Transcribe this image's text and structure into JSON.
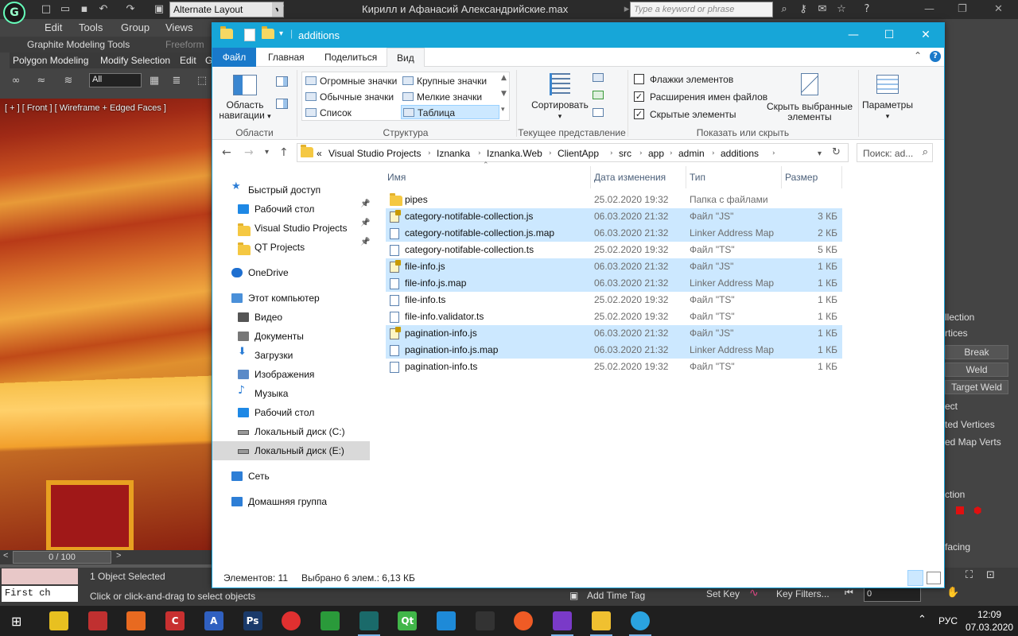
{
  "max": {
    "workspace": "Alternate Layout",
    "file_title": "Кирилл и Афанасий Александрийские.max",
    "search_placeholder": "Type a keyword or phrase",
    "menu": [
      "Edit",
      "Tools",
      "Group",
      "Views"
    ],
    "ribbon_tabs": [
      "Graphite Modeling Tools",
      "Freeform"
    ],
    "ribbon_row2": [
      "Polygon Modeling",
      "Modify Selection",
      "Edit",
      "G"
    ],
    "selection_filter": "All",
    "viewport_label": "[ + ] [ Front ] [ Wireframe + Edged Faces ]",
    "time_slider": "0 / 100",
    "maxscript_text": "First ch",
    "objects_selected": "1 Object Selected",
    "prompt": "Click or click-and-drag to select objects",
    "add_time_tag": "Add Time Tag",
    "set_key": "Set Key",
    "key_filters": "Key Filters...",
    "frame_value": "0",
    "cmd_panel": {
      "buttons": [
        "Break",
        "Weld",
        "Target Weld"
      ],
      "labels": [
        "llection",
        "rtices",
        "ect",
        "ted Vertices",
        "ed Map Verts",
        "ction",
        "facing"
      ]
    }
  },
  "explorer": {
    "title": "additions",
    "tabs": {
      "file": "Файл",
      "home": "Главная",
      "share": "Поделиться",
      "view": "Вид"
    },
    "ribbon": {
      "nav_pane_label": "Область навигации",
      "group_panes": "Области",
      "layouts": [
        "Огромные значки",
        "Крупные значки",
        "Обычные значки",
        "Мелкие значки",
        "Список",
        "Таблица"
      ],
      "group_layout": "Структура",
      "sort_label": "Сортировать",
      "group_current_view": "Текущее представление",
      "checkboxes": [
        {
          "label": "Флажки элементов",
          "checked": false
        },
        {
          "label": "Расширения имен файлов",
          "checked": true
        },
        {
          "label": "Скрытые элементы",
          "checked": true
        }
      ],
      "hide_selected": "Скрыть выбранные элементы",
      "group_show_hide": "Показать или скрыть",
      "options": "Параметры"
    },
    "address": {
      "overflow": "«",
      "segments": [
        "Visual Studio Projects",
        "Iznanka",
        "Iznanka.Web",
        "ClientApp",
        "src",
        "app",
        "admin",
        "additions"
      ],
      "search_placeholder": "Поиск: ad..."
    },
    "nav": [
      {
        "label": "Быстрый доступ",
        "level": 0,
        "icon": "star-icon",
        "pin": false
      },
      {
        "label": "Рабочий стол",
        "level": 1,
        "icon": "desktop-icon",
        "pin": true
      },
      {
        "label": "Visual Studio Projects",
        "level": 1,
        "icon": "folder-icon",
        "pin": true
      },
      {
        "label": "QT Projects",
        "level": 1,
        "icon": "folder-icon",
        "pin": true
      },
      {
        "label": "OneDrive",
        "level": 0,
        "icon": "cloud-icon",
        "pin": false
      },
      {
        "label": "Этот компьютер",
        "level": 0,
        "icon": "computer-icon",
        "pin": false
      },
      {
        "label": "Видео",
        "level": 1,
        "icon": "video-icon",
        "pin": false
      },
      {
        "label": "Документы",
        "level": 1,
        "icon": "documents-icon",
        "pin": false
      },
      {
        "label": "Загрузки",
        "level": 1,
        "icon": "downloads-icon",
        "pin": false
      },
      {
        "label": "Изображения",
        "level": 1,
        "icon": "pictures-icon",
        "pin": false
      },
      {
        "label": "Музыка",
        "level": 1,
        "icon": "music-icon",
        "pin": false
      },
      {
        "label": "Рабочий стол",
        "level": 1,
        "icon": "desktop-icon",
        "pin": false
      },
      {
        "label": "Локальный диск (C:)",
        "level": 1,
        "icon": "drive-icon",
        "pin": false
      },
      {
        "label": "Локальный диск (E:)",
        "level": 1,
        "icon": "drive-icon",
        "pin": false,
        "selected": true
      },
      {
        "label": "Сеть",
        "level": 0,
        "icon": "network-icon",
        "pin": false
      },
      {
        "label": "Домашняя группа",
        "level": 0,
        "icon": "homegroup-icon",
        "pin": false
      }
    ],
    "columns": {
      "name": "Имя",
      "date": "Дата изменения",
      "type": "Тип",
      "size": "Размер"
    },
    "files": [
      {
        "name": "pipes",
        "date": "25.02.2020 19:32",
        "type": "Папка с файлами",
        "size": "",
        "kind": "folder",
        "selected": false
      },
      {
        "name": "category-notifable-collection.js",
        "date": "06.03.2020 21:32",
        "type": "Файл \"JS\"",
        "size": "3 КБ",
        "kind": "js",
        "selected": true
      },
      {
        "name": "category-notifable-collection.js.map",
        "date": "06.03.2020 21:32",
        "type": "Linker Address Map",
        "size": "2 КБ",
        "kind": "map",
        "selected": true
      },
      {
        "name": "category-notifable-collection.ts",
        "date": "25.02.2020 19:32",
        "type": "Файл \"TS\"",
        "size": "5 КБ",
        "kind": "ts",
        "selected": false
      },
      {
        "name": "file-info.js",
        "date": "06.03.2020 21:32",
        "type": "Файл \"JS\"",
        "size": "1 КБ",
        "kind": "js",
        "selected": true
      },
      {
        "name": "file-info.js.map",
        "date": "06.03.2020 21:32",
        "type": "Linker Address Map",
        "size": "1 КБ",
        "kind": "map",
        "selected": true
      },
      {
        "name": "file-info.ts",
        "date": "25.02.2020 19:32",
        "type": "Файл \"TS\"",
        "size": "1 КБ",
        "kind": "ts",
        "selected": false
      },
      {
        "name": "file-info.validator.ts",
        "date": "25.02.2020 19:32",
        "type": "Файл \"TS\"",
        "size": "1 КБ",
        "kind": "ts",
        "selected": false
      },
      {
        "name": "pagination-info.js",
        "date": "06.03.2020 21:32",
        "type": "Файл \"JS\"",
        "size": "1 КБ",
        "kind": "js",
        "selected": true
      },
      {
        "name": "pagination-info.js.map",
        "date": "06.03.2020 21:32",
        "type": "Linker Address Map",
        "size": "1 КБ",
        "kind": "map",
        "selected": true
      },
      {
        "name": "pagination-info.ts",
        "date": "25.02.2020 19:32",
        "type": "Файл \"TS\"",
        "size": "1 КБ",
        "kind": "ts",
        "selected": false
      }
    ],
    "status": {
      "count": "Элементов: 11",
      "selected": "Выбрано 6 элем.: 6,13 КБ"
    }
  },
  "taskbar": {
    "apps": [
      {
        "name": "lightbulb-app-icon",
        "color": "#e8c020",
        "glyph": "",
        "running": false
      },
      {
        "name": "screen-app-icon",
        "color": "#c03030",
        "glyph": "",
        "running": false
      },
      {
        "name": "orange-app-icon",
        "color": "#e86a20",
        "glyph": "",
        "running": false
      },
      {
        "name": "cleaner-app-icon",
        "color": "#c83030",
        "glyph": "C",
        "running": false
      },
      {
        "name": "font-app-icon",
        "color": "#3060c0",
        "glyph": "A",
        "running": false
      },
      {
        "name": "photoshop-app-icon",
        "color": "#1a3a6a",
        "glyph": "Ps",
        "running": false
      },
      {
        "name": "opera-app-icon",
        "color": "#e03030",
        "glyph": "",
        "running": false
      },
      {
        "name": "green-app-icon",
        "color": "#2a9a3a",
        "glyph": "",
        "running": false
      },
      {
        "name": "3dsmax-app-icon",
        "color": "#1a6a6a",
        "glyph": "",
        "running": true
      },
      {
        "name": "qt-app-icon",
        "color": "#41b649",
        "glyph": "Qt",
        "running": false
      },
      {
        "name": "vscode-app-icon",
        "color": "#1e8ad8",
        "glyph": "",
        "running": false
      },
      {
        "name": "unity-app-icon",
        "color": "#333333",
        "glyph": "",
        "running": false
      },
      {
        "name": "postman-app-icon",
        "color": "#ef5b25",
        "glyph": "",
        "running": false
      },
      {
        "name": "visualstudio-app-icon",
        "color": "#7a3ac8",
        "glyph": "",
        "running": true
      },
      {
        "name": "explorer-app-icon",
        "color": "#f0c030",
        "glyph": "",
        "running": true
      },
      {
        "name": "telegram-app-icon",
        "color": "#2aa3e0",
        "glyph": "",
        "running": true
      }
    ],
    "language": "РУС",
    "time": "12:09",
    "date": "07.03.2020"
  }
}
